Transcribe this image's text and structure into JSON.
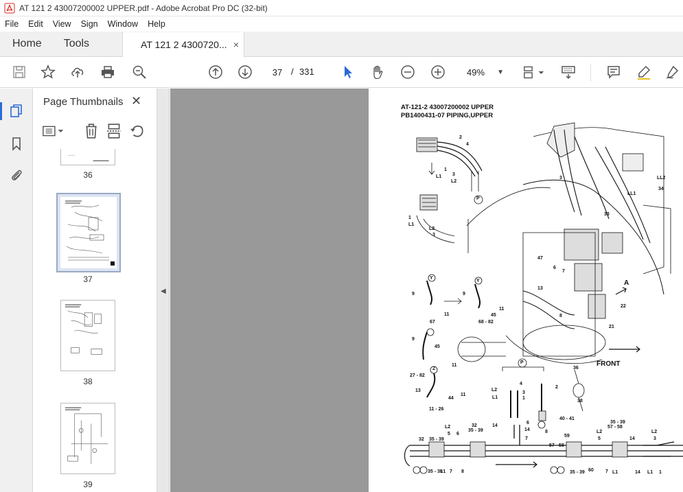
{
  "window": {
    "title": "AT 121 2 43007200002 UPPER.pdf - Adobe Acrobat Pro DC (32-bit)"
  },
  "menu": [
    "File",
    "Edit",
    "View",
    "Sign",
    "Window",
    "Help"
  ],
  "tabs": {
    "home": "Home",
    "tools": "Tools",
    "document": "AT 121 2 4300720...",
    "close": "×"
  },
  "toolbar": {
    "current_page": "37",
    "page_separator": "/",
    "total_pages": "331",
    "zoom": "49%"
  },
  "side_panel": {
    "title": "Page Thumbnails",
    "close": "✕",
    "thumbnails": [
      {
        "label": "36"
      },
      {
        "label": "37",
        "selected": true
      },
      {
        "label": "38"
      },
      {
        "label": "39"
      }
    ]
  },
  "document": {
    "title_line1": "AT-121-2 43007200002 UPPER",
    "title_line2": "PB1400431-07 PIPING,UPPER",
    "labels": {
      "front": "FRONT",
      "a": "A",
      "p": "P",
      "n1": "1",
      "n2": "2",
      "n3": "3",
      "n4": "4",
      "n5": "5",
      "n6": "6",
      "n7": "7",
      "n8": "8",
      "n9": "9",
      "n11": "11",
      "n13": "13",
      "n14": "14",
      "n21": "21",
      "n22": "22",
      "n27_82": "27 - 82",
      "n11_26": "11 - 26",
      "n33": "33",
      "n34": "34",
      "n36": "36",
      "n38": "38",
      "n40_41": "40 - 41",
      "n44": "44",
      "n45": "45",
      "n47": "47",
      "n59": "59",
      "n60": "60",
      "n67": "67",
      "n68_82": "68 - 82",
      "n57_58": "57 - 58",
      "n35_39": "35 - 39",
      "n32": "32",
      "l1": "L1",
      "l2": "L2",
      "ll1": "LL1",
      "ll2": "LL2",
      "y": "Y",
      "z": "Z",
      "hash": "#",
      "sq": "■"
    }
  }
}
